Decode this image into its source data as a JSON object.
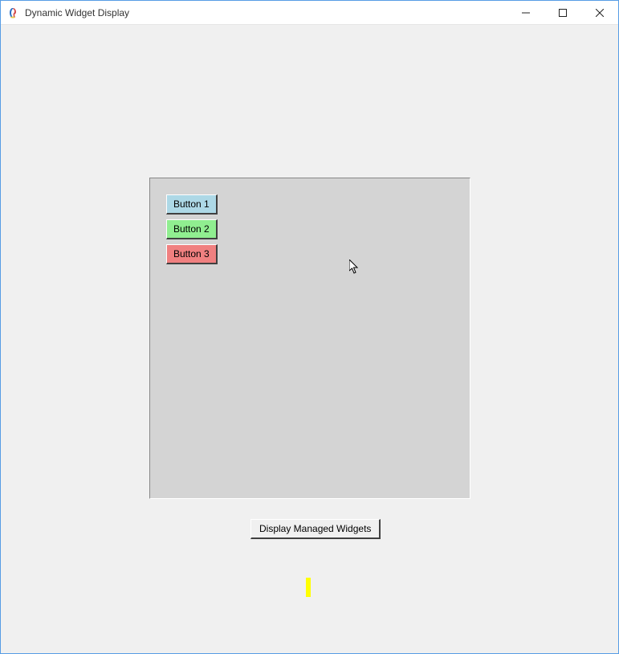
{
  "window": {
    "title": "Dynamic Widget Display"
  },
  "frame": {
    "buttons": [
      {
        "label": "Button 1",
        "color": "lightblue"
      },
      {
        "label": "Button 2",
        "color": "lightgreen"
      },
      {
        "label": "Button 3",
        "color": "lightcoral"
      }
    ]
  },
  "action_button": {
    "label": "Display Managed Widgets"
  }
}
